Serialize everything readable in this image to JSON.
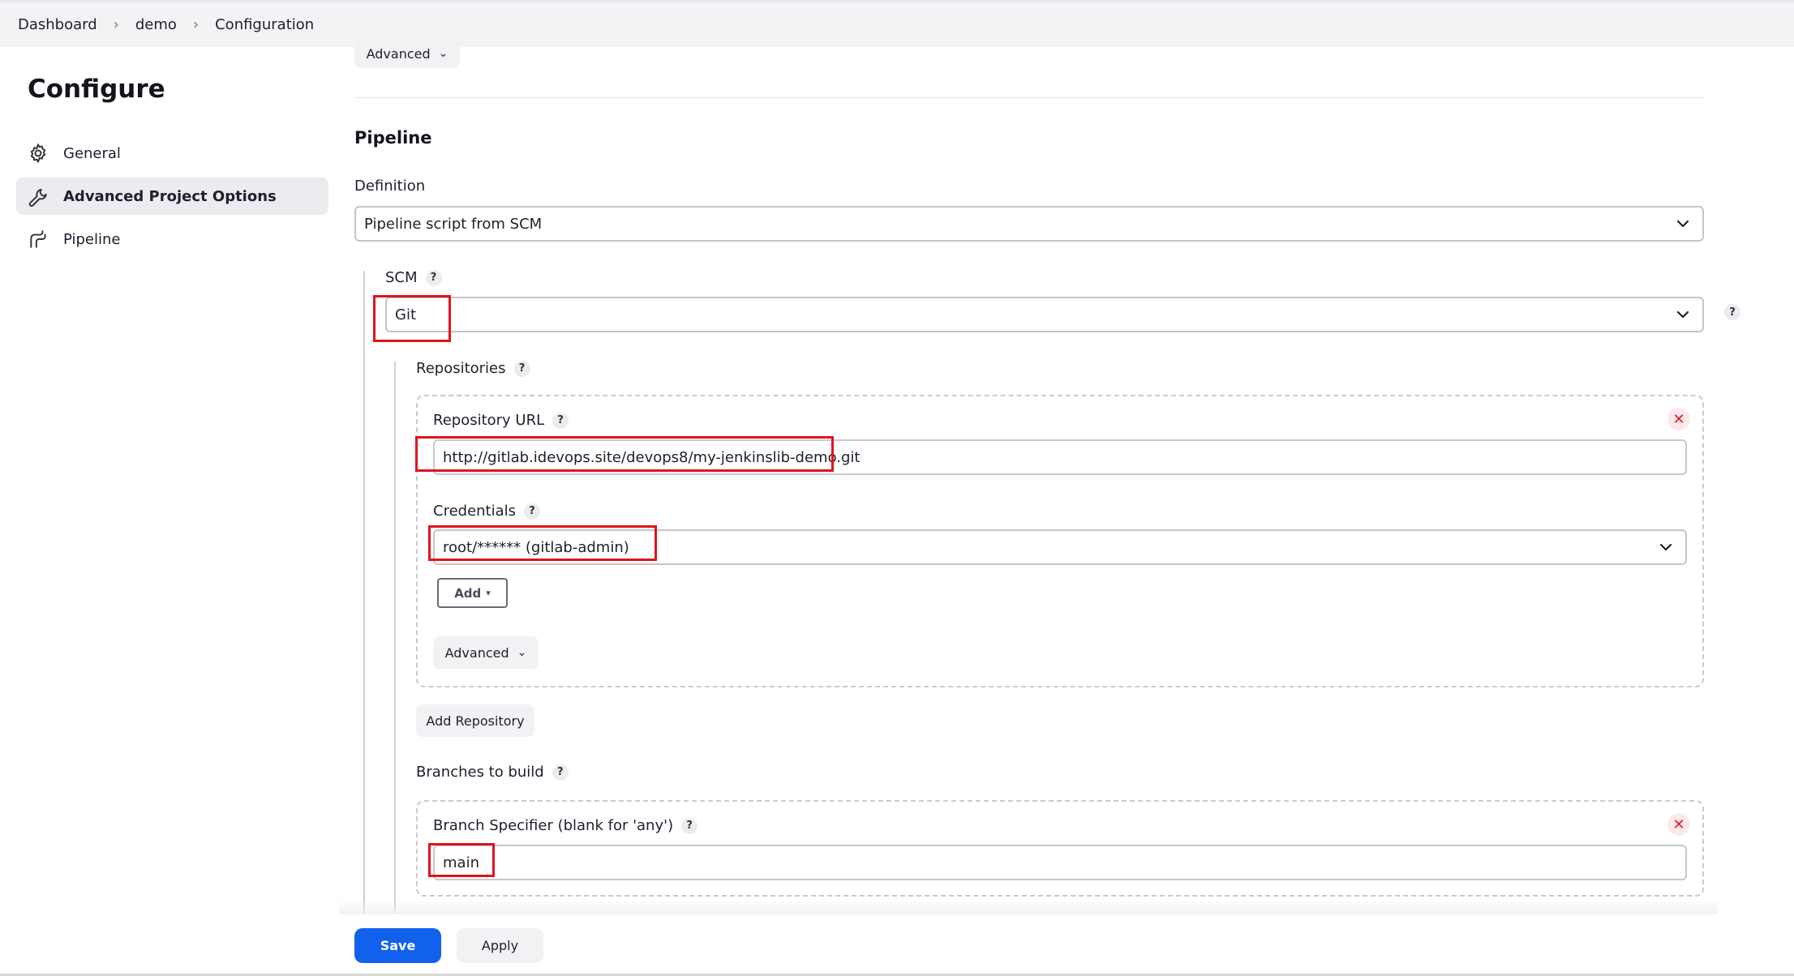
{
  "breadcrumb": {
    "items": [
      "Dashboard",
      "demo",
      "Configuration"
    ]
  },
  "sidebar": {
    "title": "Configure",
    "items": [
      {
        "label": "General",
        "icon": "gear-icon",
        "active": false
      },
      {
        "label": "Advanced Project Options",
        "icon": "wrench-icon",
        "active": true
      },
      {
        "label": "Pipeline",
        "icon": "pipeline-icon",
        "active": false
      }
    ]
  },
  "top": {
    "advanced_label": "Advanced"
  },
  "pipeline": {
    "title": "Pipeline",
    "definition_label": "Definition",
    "definition_value": "Pipeline script from SCM",
    "scm_label": "SCM",
    "scm_value": "Git",
    "repositories_label": "Repositories",
    "repository_url_label": "Repository URL",
    "repository_url_value": "http://gitlab.idevops.site/devops8/my-jenkinslib-demo.git",
    "credentials_label": "Credentials",
    "credentials_value": "root/****** (gitlab-admin)",
    "add_label": "Add",
    "repo_advanced_label": "Advanced",
    "add_repository_label": "Add Repository",
    "branches_label": "Branches to build",
    "branch_specifier_label": "Branch Specifier (blank for 'any')",
    "branch_specifier_value": "main"
  },
  "footer": {
    "save_label": "Save",
    "apply_label": "Apply"
  },
  "colors": {
    "primary": "#1261ed",
    "highlight": "#e0141e",
    "remove": "#d21f2d"
  }
}
